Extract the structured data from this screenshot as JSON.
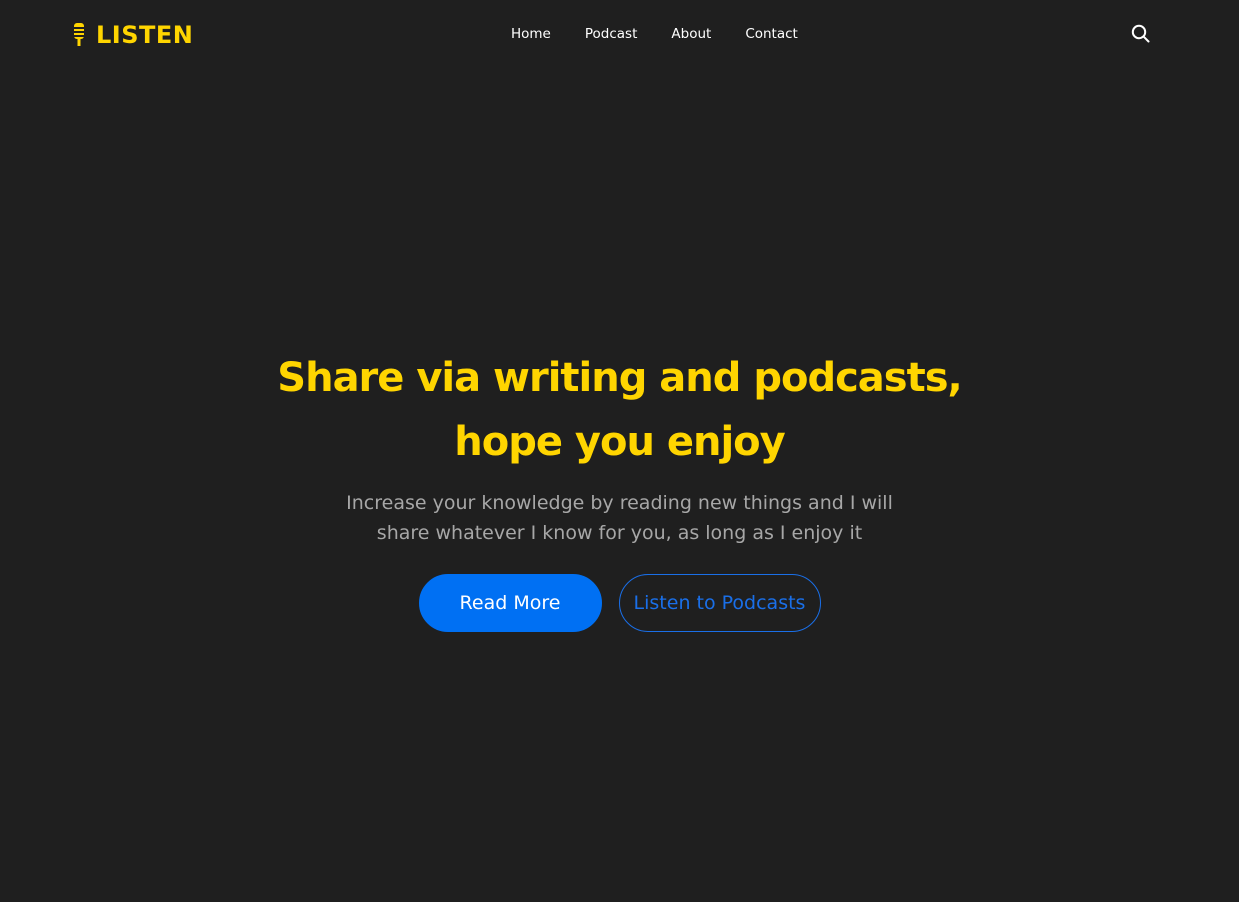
{
  "brand": {
    "name": "LISTEN",
    "logo_icon": "microphone-icon",
    "accent_color": "#ffd500"
  },
  "nav": {
    "items": [
      {
        "label": "Home"
      },
      {
        "label": "Podcast"
      },
      {
        "label": "About"
      },
      {
        "label": "Contact"
      }
    ],
    "search_icon": "search-icon"
  },
  "hero": {
    "title": "Share via writing and podcasts, hope you enjoy",
    "subtitle": "Increase your knowledge by reading new things and I will share whatever I know for you, as long as I enjoy it",
    "primary_button": "Read More",
    "secondary_button": "Listen to Podcasts"
  },
  "colors": {
    "background": "#1f1f1f",
    "title": "#ffd500",
    "subtitle": "#a7a7a7",
    "primary_button": "#0070f3",
    "secondary_button_border": "#1a6fe8"
  }
}
